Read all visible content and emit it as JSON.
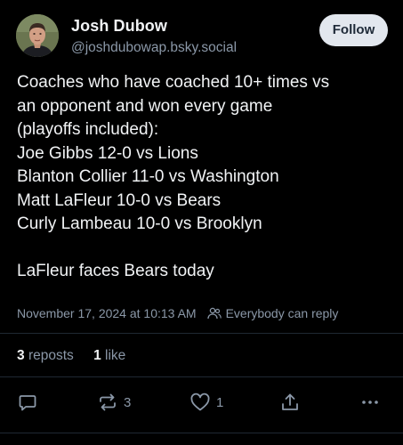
{
  "author": {
    "name": "Josh Dubow",
    "handle": "@joshdubowap.bsky.social"
  },
  "follow_button": {
    "label": "Follow"
  },
  "post": {
    "lines": [
      "Coaches who have coached 10+ times vs",
      "an opponent and won every game",
      "(playoffs included):",
      "Joe Gibbs 12-0 vs Lions",
      "Blanton Collier 11-0 vs Washington",
      "Matt LaFleur 10-0 vs Bears",
      "Curly Lambeau 10-0 vs Brooklyn",
      "",
      "LaFleur faces Bears today"
    ],
    "timestamp": "November 17, 2024 at 10:13 AM",
    "reply_setting": "Everybody can reply"
  },
  "stats": {
    "reposts_count": "3",
    "reposts_label": "reposts",
    "likes_count": "1",
    "likes_label": "like"
  },
  "actions": {
    "reply_icon": "reply-icon",
    "repost_icon": "repost-icon",
    "repost_count": "3",
    "like_icon": "heart-icon",
    "like_count": "1",
    "share_icon": "share-icon",
    "more_icon": "more-icon"
  },
  "colors": {
    "background": "#000000",
    "text": "#f1f3f5",
    "muted": "#8b98a8",
    "follow_button_bg": "#e2e7ee",
    "follow_button_text": "#1e2a38"
  }
}
